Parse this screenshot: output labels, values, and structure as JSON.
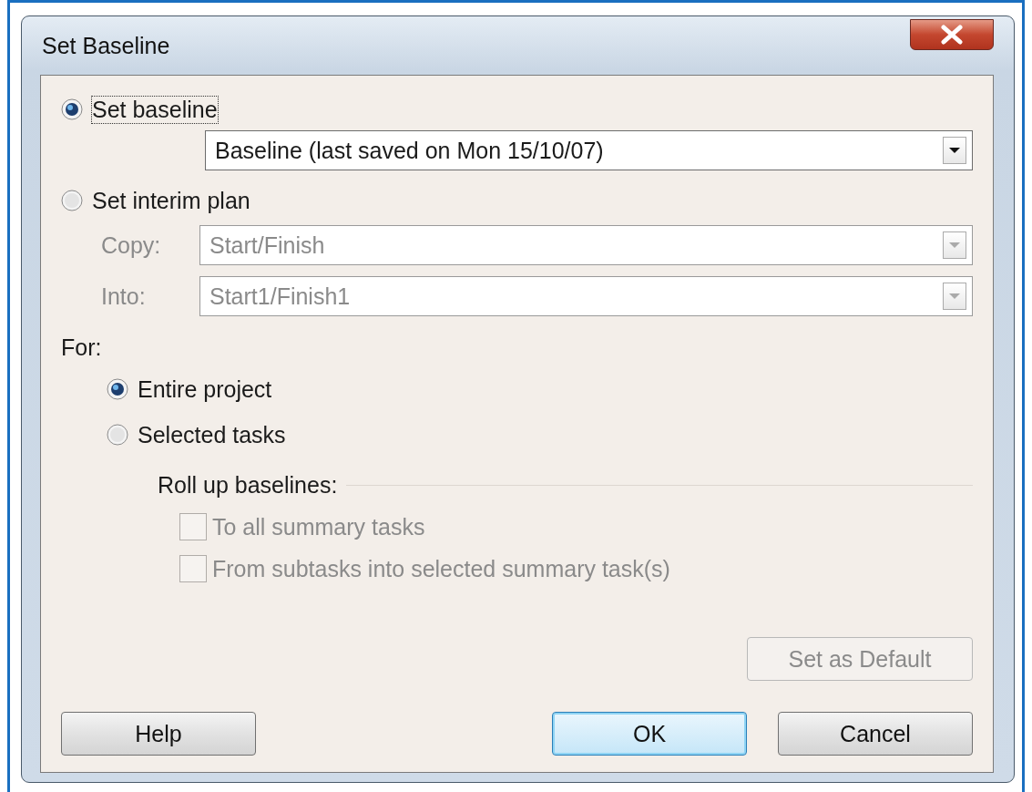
{
  "window": {
    "title": "Set Baseline"
  },
  "mode_options": [
    {
      "label": "Set baseline",
      "selected": true
    },
    {
      "label": "Set interim plan",
      "selected": false
    }
  ],
  "baseline_select": {
    "value": "Baseline (last saved on Mon 15/10/07)",
    "disabled": false
  },
  "interim_fields": [
    {
      "label": "Copy:",
      "value": "Start/Finish",
      "disabled": true
    },
    {
      "label": "Into:",
      "value": "Start1/Finish1",
      "disabled": true
    }
  ],
  "for_label": "For:",
  "scope_options": [
    {
      "label": "Entire project",
      "selected": true
    },
    {
      "label": "Selected tasks",
      "selected": false
    }
  ],
  "rollup": {
    "title": "Roll up baselines:",
    "options": [
      {
        "label": "To all summary tasks",
        "checked": false,
        "disabled": true
      },
      {
        "label": "From subtasks into selected summary task(s)",
        "checked": false,
        "disabled": true
      }
    ]
  },
  "default_button": {
    "label": "Set as Default",
    "disabled": true
  },
  "buttons": [
    {
      "label": "Help",
      "default": false
    },
    {
      "label": "OK",
      "default": true
    },
    {
      "label": "Cancel",
      "default": false
    }
  ]
}
